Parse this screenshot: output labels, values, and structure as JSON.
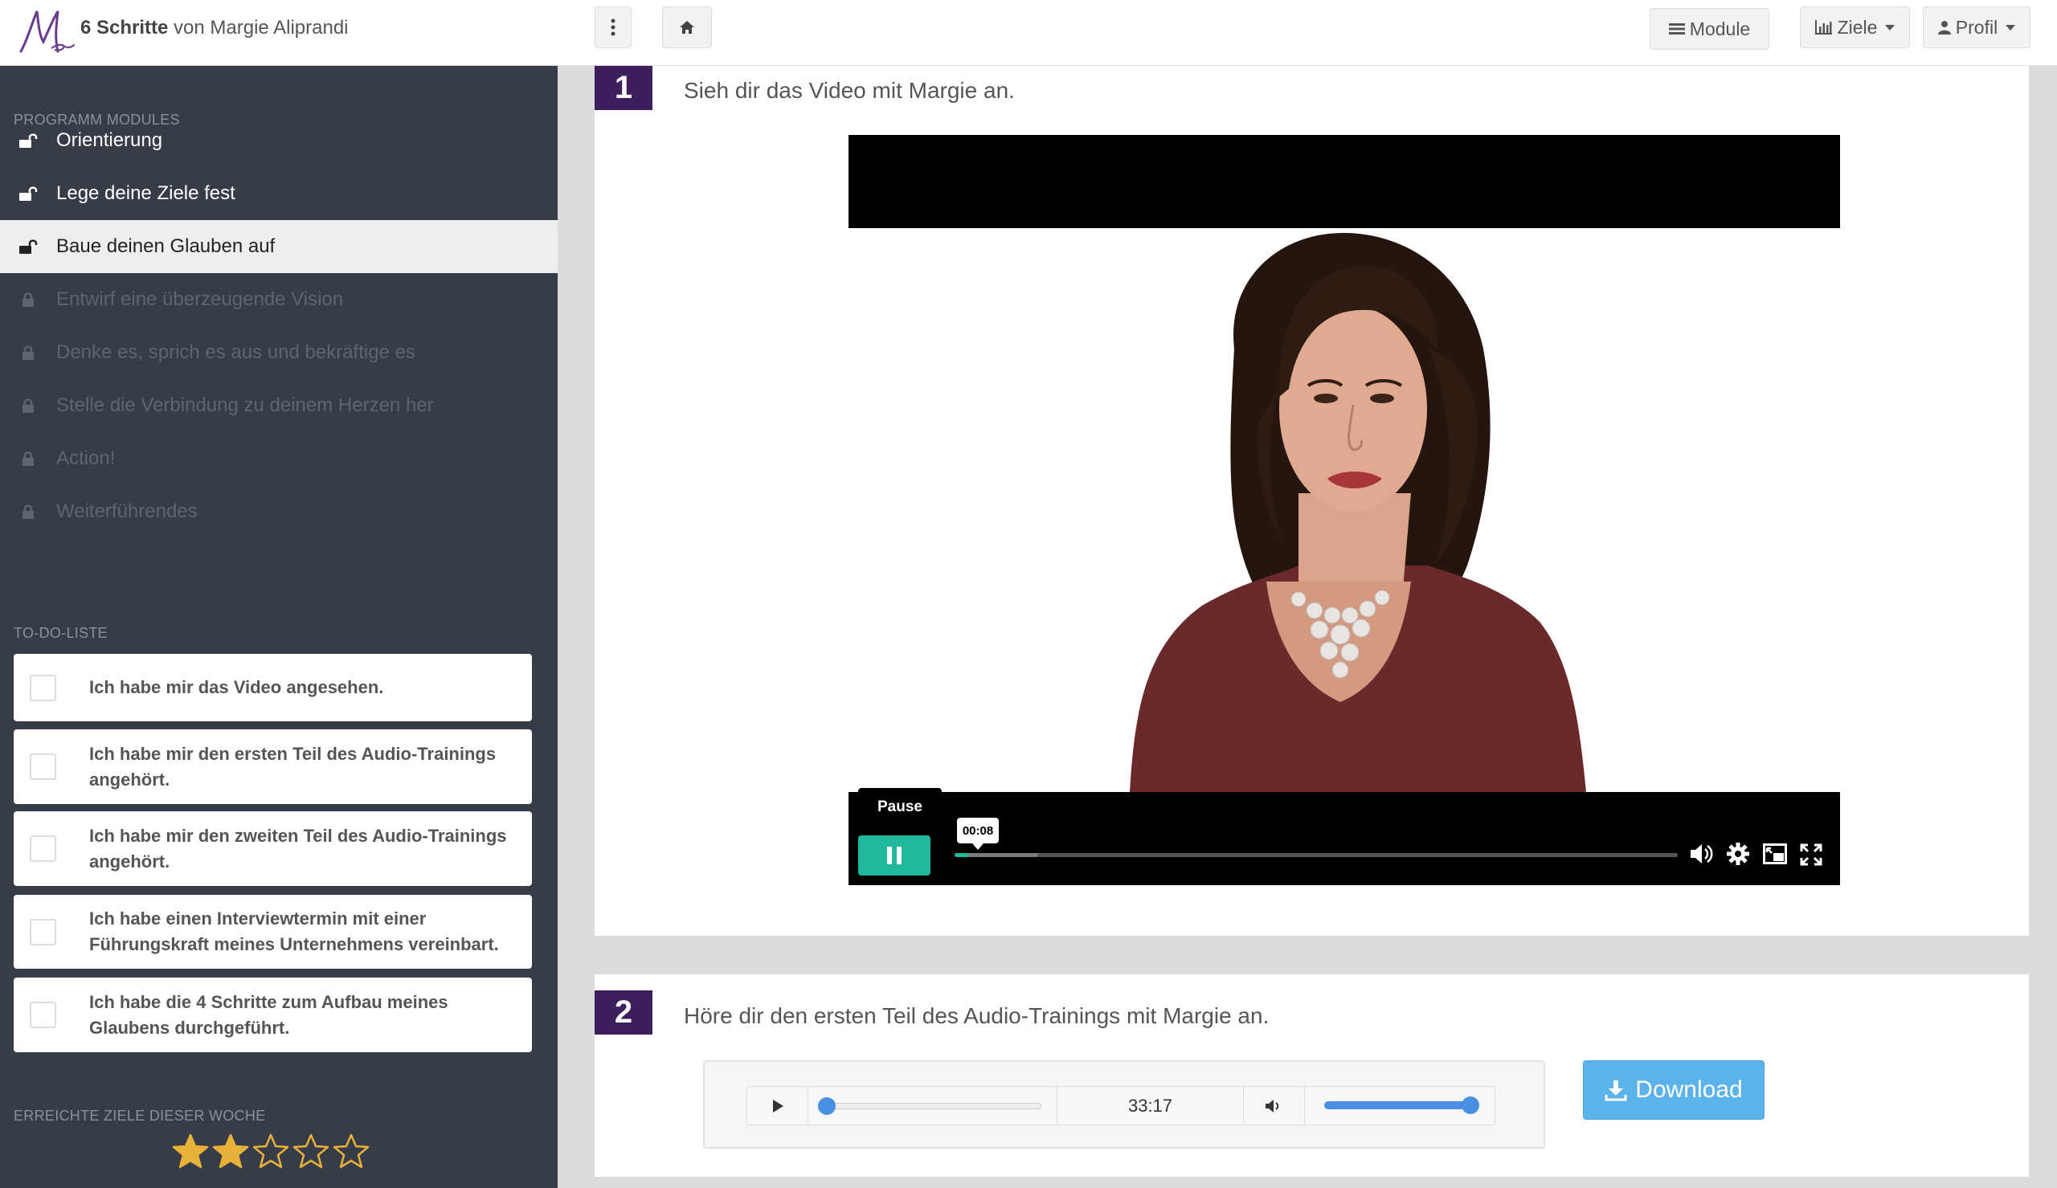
{
  "header": {
    "brand_bold": "6 Schritte",
    "brand_rest": " von Margie Aliprandi",
    "module_label": "Module",
    "goals_label": "Ziele",
    "profile_label": "Profil"
  },
  "sidebar": {
    "modules_title": "PROGRAMM MODULES",
    "modules": [
      {
        "label": "Orientierung",
        "state": "unlocked"
      },
      {
        "label": "Lege deine Ziele fest",
        "state": "unlocked"
      },
      {
        "label": "Baue deinen Glauben auf",
        "state": "active"
      },
      {
        "label": "Entwirf eine überzeugende Vision",
        "state": "locked"
      },
      {
        "label": "Denke es, sprich es aus und bekräftige es",
        "state": "locked"
      },
      {
        "label": "Stelle die Verbindung zu deinem Herzen her",
        "state": "locked"
      },
      {
        "label": "Action!",
        "state": "locked"
      },
      {
        "label": "Weiterführendes",
        "state": "locked"
      }
    ],
    "todo_title": "TO-DO-LISTE",
    "todos": [
      {
        "text": "Ich habe mir das Video angesehen.",
        "checked": false
      },
      {
        "text": "Ich habe mir den ersten Teil des Audio-Trainings angehört.",
        "checked": false
      },
      {
        "text": "Ich habe mir den zweiten Teil des Audio-Trainings angehört.",
        "checked": false
      },
      {
        "text": "Ich habe einen Interviewtermin mit einer Führungskraft meines Unternehmens vereinbart.",
        "checked": false
      },
      {
        "text": "Ich habe die 4 Schritte zum Aufbau meines Glaubens durchgeführt.",
        "checked": false
      }
    ],
    "goals_title": "ERREICHTE ZIELE DIESER WOCHE",
    "stars_filled": 2,
    "stars_total": 5
  },
  "steps": [
    {
      "number": "1",
      "title": "Sieh dir das Video mit Margie an."
    },
    {
      "number": "2",
      "title": "Höre dir den ersten Teil des Audio-Trainings mit Margie an."
    }
  ],
  "video": {
    "pause_tooltip": "Pause",
    "time_tooltip": "00:08",
    "progress_fraction": 0.02,
    "buffered_fraction": 0.115
  },
  "audio": {
    "duration": "33:17",
    "progress_fraction": 0.0,
    "volume_fraction": 1.0,
    "download_label": "Download"
  },
  "colors": {
    "sidebar_bg": "#363c48",
    "step_badge": "#3d1f5e",
    "accent_teal": "#1fb89a",
    "download_blue": "#5cb3ea",
    "star_gold": "#e8b23a",
    "slider_blue": "#4a90e2"
  }
}
